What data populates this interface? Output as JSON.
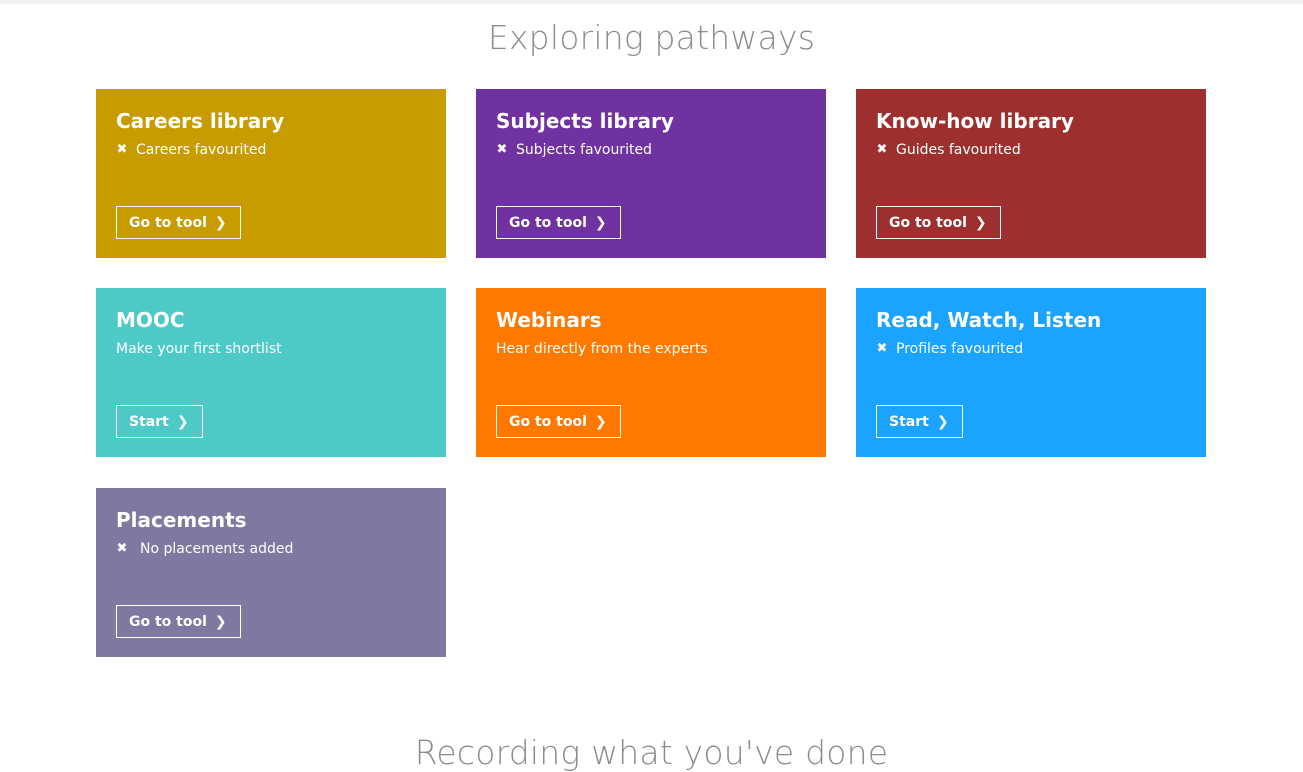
{
  "page": {
    "section_title": "Exploring pathways",
    "next_section_title": "Recording what you've done"
  },
  "cards": [
    {
      "title": "Careers library",
      "status": "Careers favourited",
      "status_icon": "x-icon",
      "button": "Go to tool",
      "color": "#c89b00"
    },
    {
      "title": "Subjects library",
      "status": "Subjects favourited",
      "status_icon": "x-icon",
      "button": "Go to tool",
      "color": "#6f32a0"
    },
    {
      "title": "Know-how library",
      "status": "Guides favourited",
      "status_icon": "x-icon",
      "button": "Go to tool",
      "color": "#9e2f2f"
    },
    {
      "title": "MOOC",
      "status": "Make your first shortlist",
      "status_icon": "",
      "button": "Start",
      "color": "#4dc9c8"
    },
    {
      "title": "Webinars",
      "status": "Hear directly from the experts",
      "status_icon": "",
      "button": "Go to tool",
      "color": "#ff7800"
    },
    {
      "title": "Read, Watch, Listen",
      "status": "Profiles favourited",
      "status_icon": "x-icon",
      "button": "Start",
      "color": "#1aa3ff"
    },
    {
      "title": "Placements",
      "status": "No placements added",
      "status_icon": "x-icon",
      "button": "Go to tool",
      "color": "#7f78a1"
    }
  ]
}
